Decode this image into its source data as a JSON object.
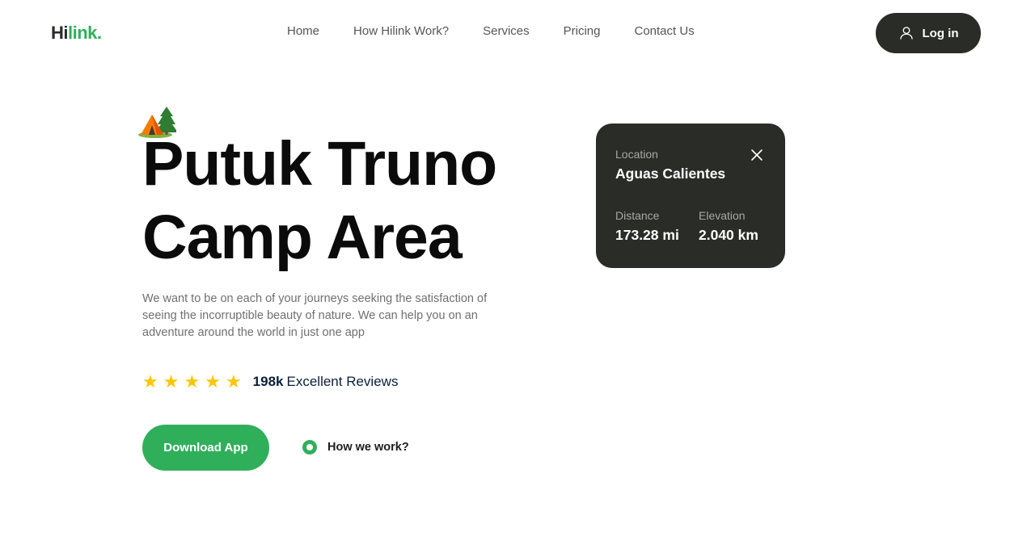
{
  "header": {
    "logo_main": "Hi",
    "logo_accent": "link.",
    "nav": [
      "Home",
      "How Hilink Work?",
      "Services",
      "Pricing",
      "Contact Us"
    ],
    "login_label": "Log in"
  },
  "hero": {
    "title_line1": "Putuk Truno",
    "title_line2": "Camp Area",
    "description": "We want to be on each of your journeys seeking the satisfaction of seeing the incorruptible beauty of nature. We can help you on an adventure around the world in just one app",
    "rating_stars": 5,
    "reviews_count": "198k",
    "reviews_label": "Excellent Reviews",
    "download_label": "Download App",
    "how_work_label": "How we work?"
  },
  "location_card": {
    "location_label": "Location",
    "location_value": "Aguas Calientes",
    "distance_label": "Distance",
    "distance_value": "173.28 mi",
    "elevation_label": "Elevation",
    "elevation_value": "2.040 km"
  },
  "colors": {
    "accent": "#30af5b",
    "dark": "#292c27",
    "star": "#fec601"
  },
  "icons": [
    "user-icon",
    "camp-tent-icon",
    "star-icon",
    "play-icon",
    "close-icon"
  ]
}
